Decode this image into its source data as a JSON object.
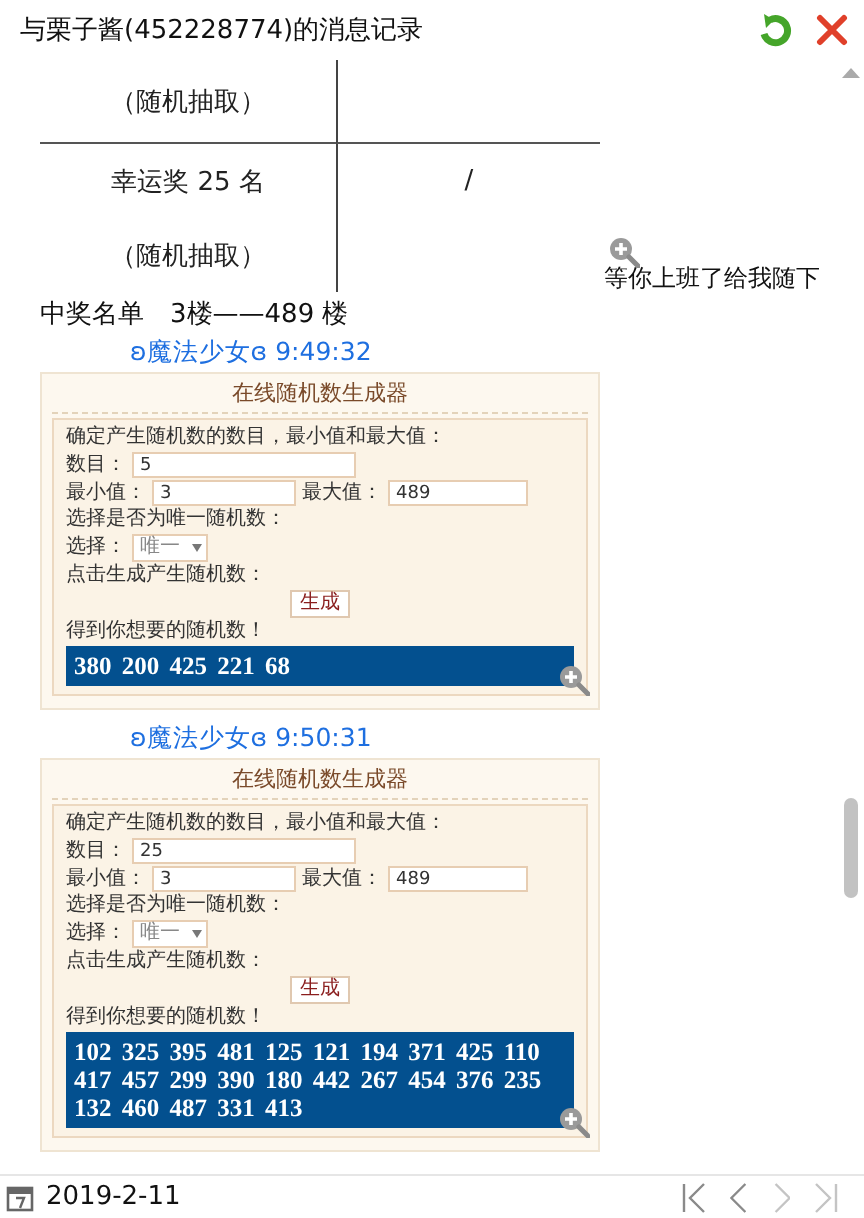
{
  "window": {
    "title": "与栗子酱(452228774)的消息记录"
  },
  "first_message": {
    "table_rows": [
      {
        "column_1": "（随机抽取）"
      },
      {
        "column_1": "幸运奖 25 名",
        "column_2": "/"
      },
      {
        "column_1": "（随机抽取）"
      }
    ],
    "caption": "等你上班了给我随下",
    "text": "中奖名单　3楼——489 楼"
  },
  "messages": [
    {
      "sender": "ʚ魔法少女ɞ",
      "time": "9:49:32",
      "generator": {
        "title": "在线随机数生成器",
        "intro": "确定产生随机数的数目，最小值和最大值：",
        "count_label": "数目：",
        "count": "5",
        "min_label": "最小值：",
        "min": "3",
        "max_label": "最大值：",
        "max": "489",
        "unique_prompt": "选择是否为唯一随机数：",
        "choice_label": "选择：",
        "choice": "唯一",
        "generate_prompt": "点击生成产生随机数：",
        "button": "生成",
        "result_label": "得到你想要的随机数！",
        "result": "380 200 425 221 68"
      }
    },
    {
      "sender": "ʚ魔法少女ɞ",
      "time": "9:50:31",
      "generator": {
        "title": "在线随机数生成器",
        "intro": "确定产生随机数的数目，最小值和最大值：",
        "count_label": "数目：",
        "count": "25",
        "min_label": "最小值：",
        "min": "3",
        "max_label": "最大值：",
        "max": "489",
        "unique_prompt": "选择是否为唯一随机数：",
        "choice_label": "选择：",
        "choice": "唯一",
        "generate_prompt": "点击生成产生随机数：",
        "button": "生成",
        "result_label": "得到你想要的随机数！",
        "result": "102 325 395 481 125 121 194 371 425 110 417 457 299 390 180 442 267 454 376 235 132 460 487 331 413"
      }
    }
  ],
  "status_bar": {
    "date": "2019-2-11",
    "nav": [
      {
        "kind": "first",
        "disabled": false
      },
      {
        "kind": "prev",
        "disabled": false
      },
      {
        "kind": "next",
        "disabled": true
      },
      {
        "kind": "last",
        "disabled": true
      }
    ]
  }
}
